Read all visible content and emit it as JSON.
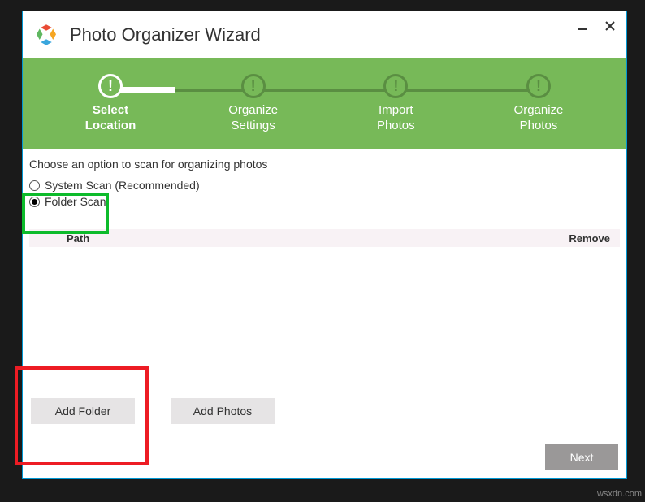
{
  "titlebar": {
    "title": "Photo Organizer Wizard"
  },
  "steps": [
    {
      "line1": "Select",
      "line2": "Location",
      "active": true
    },
    {
      "line1": "Organize",
      "line2": "Settings",
      "active": false
    },
    {
      "line1": "Import",
      "line2": "Photos",
      "active": false
    },
    {
      "line1": "Organize",
      "line2": "Photos",
      "active": false
    }
  ],
  "content": {
    "instruction": "Choose an option to scan for organizing photos",
    "options": {
      "system_scan": "System Scan (Recommended)",
      "folder_scan": "Folder Scan"
    },
    "table": {
      "col_path": "Path",
      "col_remove": "Remove"
    },
    "buttons": {
      "add_folder": "Add Folder",
      "add_photos": "Add Photos",
      "next": "Next"
    }
  },
  "watermark": "wsxdn.com"
}
